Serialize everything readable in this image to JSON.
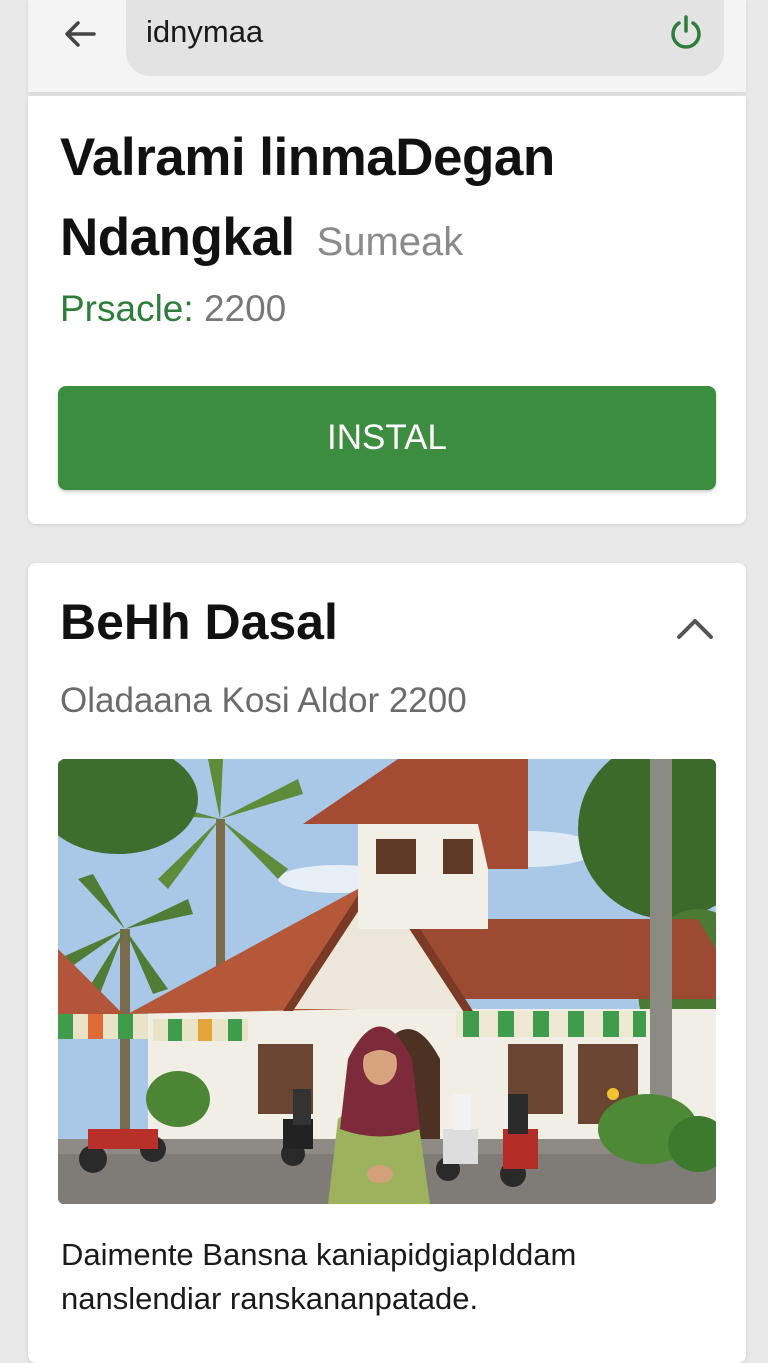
{
  "toolbar": {
    "back_icon": "arrow-left-icon",
    "search_value": "idnymaa",
    "power_icon": "power-icon",
    "accent": "#3c8d40"
  },
  "app": {
    "title": "Valrami linmaDegan Ndangkal",
    "subtitle": "Sumeak",
    "price_label": "Prsacle:",
    "price_value": "2200",
    "install_label": "INSTAL"
  },
  "section": {
    "title": "BeHh Dasal",
    "collapse_icon": "chevron-up-icon",
    "subtitle": "Oladaana Kosi Aldor 2200",
    "description": "Daimente Bansna kaniapidgiapIddam nanslendiar ranskananpatade."
  },
  "colors": {
    "green": "#3c8d40",
    "price_green": "#2e7d3a"
  }
}
